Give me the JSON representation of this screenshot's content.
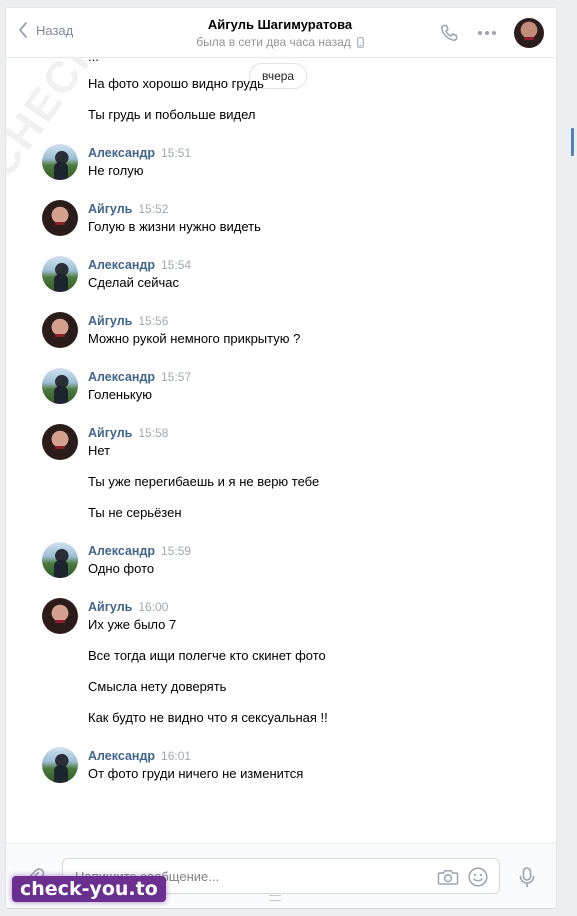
{
  "header": {
    "back_label": "Назад",
    "peer_name": "Айгуль Шагимуратова",
    "peer_status": "была в сети два часа назад",
    "icons": [
      "phone-icon",
      "more-icon",
      "avatar"
    ]
  },
  "history": {
    "partial_top_line": "...",
    "date_label": "вчера",
    "initial_messages": [
      "На фото хорошо видно грудь",
      "Ты грудь и побольше видел"
    ],
    "groups": [
      {
        "sender": "Александр",
        "time": "15:51",
        "messages": [
          "Не голую"
        ]
      },
      {
        "sender": "Айгуль",
        "time": "15:52",
        "messages": [
          "Голую в жизни нужно видеть"
        ]
      },
      {
        "sender": "Александр",
        "time": "15:54",
        "messages": [
          "Сделай сейчас"
        ]
      },
      {
        "sender": "Айгуль",
        "time": "15:56",
        "messages": [
          "Можно рукой немного прикрытую ?"
        ]
      },
      {
        "sender": "Александр",
        "time": "15:57",
        "messages": [
          "Голенькую"
        ]
      },
      {
        "sender": "Айгуль",
        "time": "15:58",
        "messages": [
          "Нет",
          "Ты уже перегибаешь и я не верю тебе",
          "Ты не серьёзен"
        ]
      },
      {
        "sender": "Александр",
        "time": "15:59",
        "messages": [
          "Одно фото"
        ]
      },
      {
        "sender": "Айгуль",
        "time": "16:00",
        "messages": [
          "Их уже было 7",
          "Все тогда ищи полегче кто скинет фото",
          "Смысла нету доверять",
          "Как будто не видно что я сексуальная !!"
        ]
      },
      {
        "sender": "Александр",
        "time": "16:01",
        "messages": [
          "От фото груди ничего не изменится"
        ]
      }
    ]
  },
  "composer": {
    "placeholder": "Напишите сообщение..."
  },
  "watermark": {
    "text": "CHECK-YOU.ME",
    "badge": "check-you.to"
  },
  "colors": {
    "name_link": "#42648b",
    "time": "#a0a8b3",
    "background": "#edeef0",
    "accent": "#5181b8"
  }
}
